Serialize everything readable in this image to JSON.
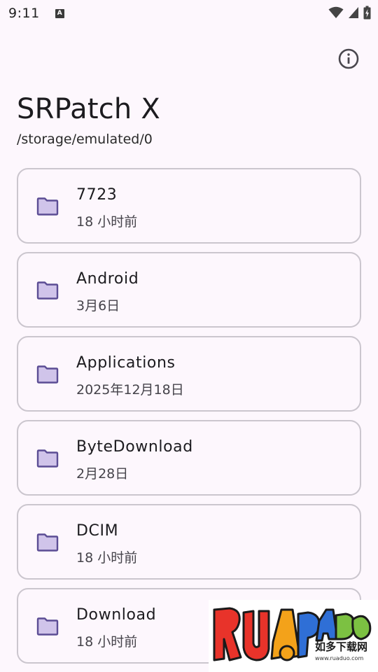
{
  "status_bar": {
    "time": "9:11",
    "notification_badge": "A",
    "icons": [
      "wifi-icon",
      "cell-signal-icon",
      "battery-charging-icon"
    ]
  },
  "app": {
    "title": "SRPatch X",
    "path": "/storage/emulated/0",
    "info_icon": "info-icon"
  },
  "colors": {
    "background": "#fdf7fd",
    "card_border": "#cbc6ce",
    "folder_fill": "#d0c4ea",
    "folder_stroke": "#5b4d94"
  },
  "folders": [
    {
      "name": "7723",
      "date": "18 小时前"
    },
    {
      "name": "Android",
      "date": "3月6日"
    },
    {
      "name": "Applications",
      "date": "2025年12月18日"
    },
    {
      "name": "ByteDownload",
      "date": "2月28日"
    },
    {
      "name": "DCIM",
      "date": "18 小时前"
    },
    {
      "name": "Download",
      "date": "18 小时前"
    }
  ],
  "watermark": {
    "logo_text": "RUANDUO",
    "caption_cn": "如多下载网",
    "url": "www.ruaduo.com"
  }
}
